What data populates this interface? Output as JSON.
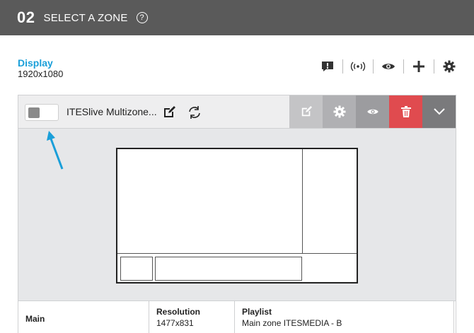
{
  "header": {
    "step_number": "02",
    "title": "SELECT A ZONE",
    "help_symbol": "?"
  },
  "display": {
    "label": "Display",
    "resolution": "1920x1080"
  },
  "toolbar": {
    "icons": [
      "alert-icon",
      "broadcast-icon",
      "eye-icon",
      "plus-icon",
      "gear-icon"
    ]
  },
  "zone": {
    "name": "ITESlive Multizone...",
    "toggle_on": false,
    "actions": [
      "edit",
      "settings",
      "preview",
      "delete",
      "expand"
    ],
    "colors": {
      "delete": "#e04b4f",
      "accent": "#1a9fd9"
    }
  },
  "details": {
    "name": "Main",
    "resolution_label": "Resolution",
    "resolution_value": "1477x831",
    "playlist_label": "Playlist",
    "playlist_value": "Main zone ITESMEDIA - B"
  }
}
